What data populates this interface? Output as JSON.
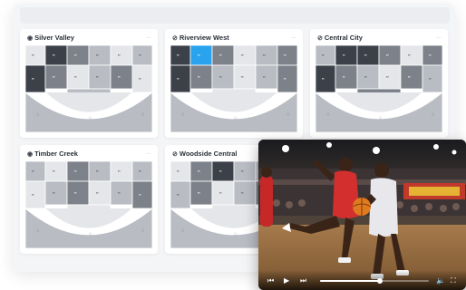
{
  "header": {
    "label": ""
  },
  "cards": [
    {
      "title": "Silver Valley",
      "glyph": "◉",
      "menu": "..."
    },
    {
      "title": "Riverview West",
      "glyph": "⊘",
      "menu": "..."
    },
    {
      "title": "Central City",
      "glyph": "⊘",
      "menu": "..."
    },
    {
      "title": "Timber Creek",
      "glyph": "◉",
      "menu": "..."
    },
    {
      "title": "Woodside Central",
      "glyph": "⊘",
      "menu": "..."
    }
  ],
  "colors": {
    "dark": "#3b4049",
    "mid": "#7d828a",
    "light": "#b9bdc3",
    "pale": "#e4e6e9",
    "highlight": "#2aa3ef"
  },
  "video": {
    "progress": 0.55,
    "icons": [
      "skip-back-icon",
      "play-icon",
      "skip-forward-icon",
      "volume-icon",
      "fullscreen-icon"
    ]
  }
}
